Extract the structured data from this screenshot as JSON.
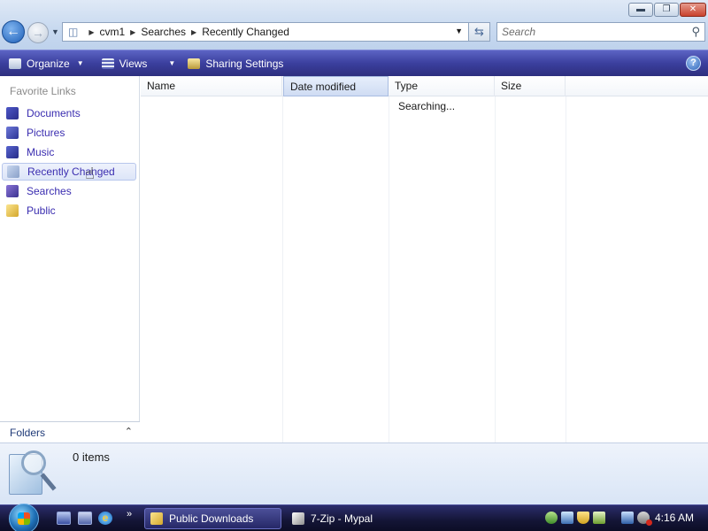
{
  "window": {
    "minimize_glyph": "▬",
    "maximize_glyph": "❐",
    "close_glyph": "✕"
  },
  "nav": {
    "back_glyph": "←",
    "forward_glyph": "→",
    "recent_dropdown_glyph": "▼"
  },
  "address": {
    "crumbs": [
      "cvm1",
      "Searches",
      "Recently Changed"
    ],
    "separator": "▶",
    "dropdown_glyph": "▼",
    "refresh_glyph": "⇆"
  },
  "search": {
    "placeholder": "Search",
    "icon": "search-icon",
    "icon_glyph": "⚲"
  },
  "toolbar": {
    "organize_label": "Organize",
    "views_label": "Views",
    "sharing_label": "Sharing Settings",
    "caret_glyph": "▼",
    "help_glyph": "?"
  },
  "sidebar": {
    "title": "Favorite Links",
    "items": [
      {
        "label": "Documents",
        "icon": "documents-icon"
      },
      {
        "label": "Pictures",
        "icon": "pictures-icon"
      },
      {
        "label": "Music",
        "icon": "music-icon"
      },
      {
        "label": "Recently Changed",
        "icon": "recently-changed-icon",
        "selected": true
      },
      {
        "label": "Searches",
        "icon": "searches-icon"
      },
      {
        "label": "Public",
        "icon": "public-folder-icon"
      }
    ],
    "folders_label": "Folders",
    "folders_chevron": "⌃"
  },
  "filelist": {
    "columns": [
      "Name",
      "Date modified",
      "Type",
      "Size"
    ],
    "sorted_column": "Date modified",
    "status_text": "Searching..."
  },
  "details": {
    "item_count": "0 items"
  },
  "taskbar": {
    "more_glyph": "»",
    "ie_glyph": "e",
    "tasks": [
      {
        "label": "Public Downloads",
        "active": true
      },
      {
        "label": "7-Zip - Mypal",
        "active": false
      }
    ],
    "clock": "4:16 AM"
  },
  "colors": {
    "command_bar": "#3b3f9e",
    "link_text": "#3a2db0",
    "taskbar": "#141536",
    "details_pane": "#d9e5f6"
  }
}
